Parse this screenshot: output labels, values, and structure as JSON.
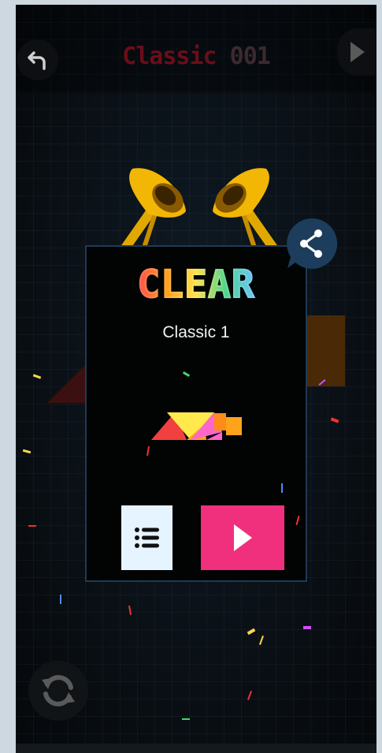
{
  "header": {
    "title_mode": "Classic",
    "title_number": "001",
    "back_icon": "undo-arrow-icon",
    "next_icon": "play-triangle-icon"
  },
  "dialog": {
    "heading": "CLEAR",
    "level_name": "Classic 1",
    "levels_button_icon": "list-icon",
    "next_button_icon": "play-triangle-icon",
    "share_icon": "share-icon"
  },
  "footer": {
    "restart_icon": "refresh-icon"
  },
  "colors": {
    "accent_pink": "#f0307c",
    "levels_button_bg": "#e6f4ff",
    "share_bg": "#1c3d5c",
    "title_red": "#6a0e1a"
  }
}
